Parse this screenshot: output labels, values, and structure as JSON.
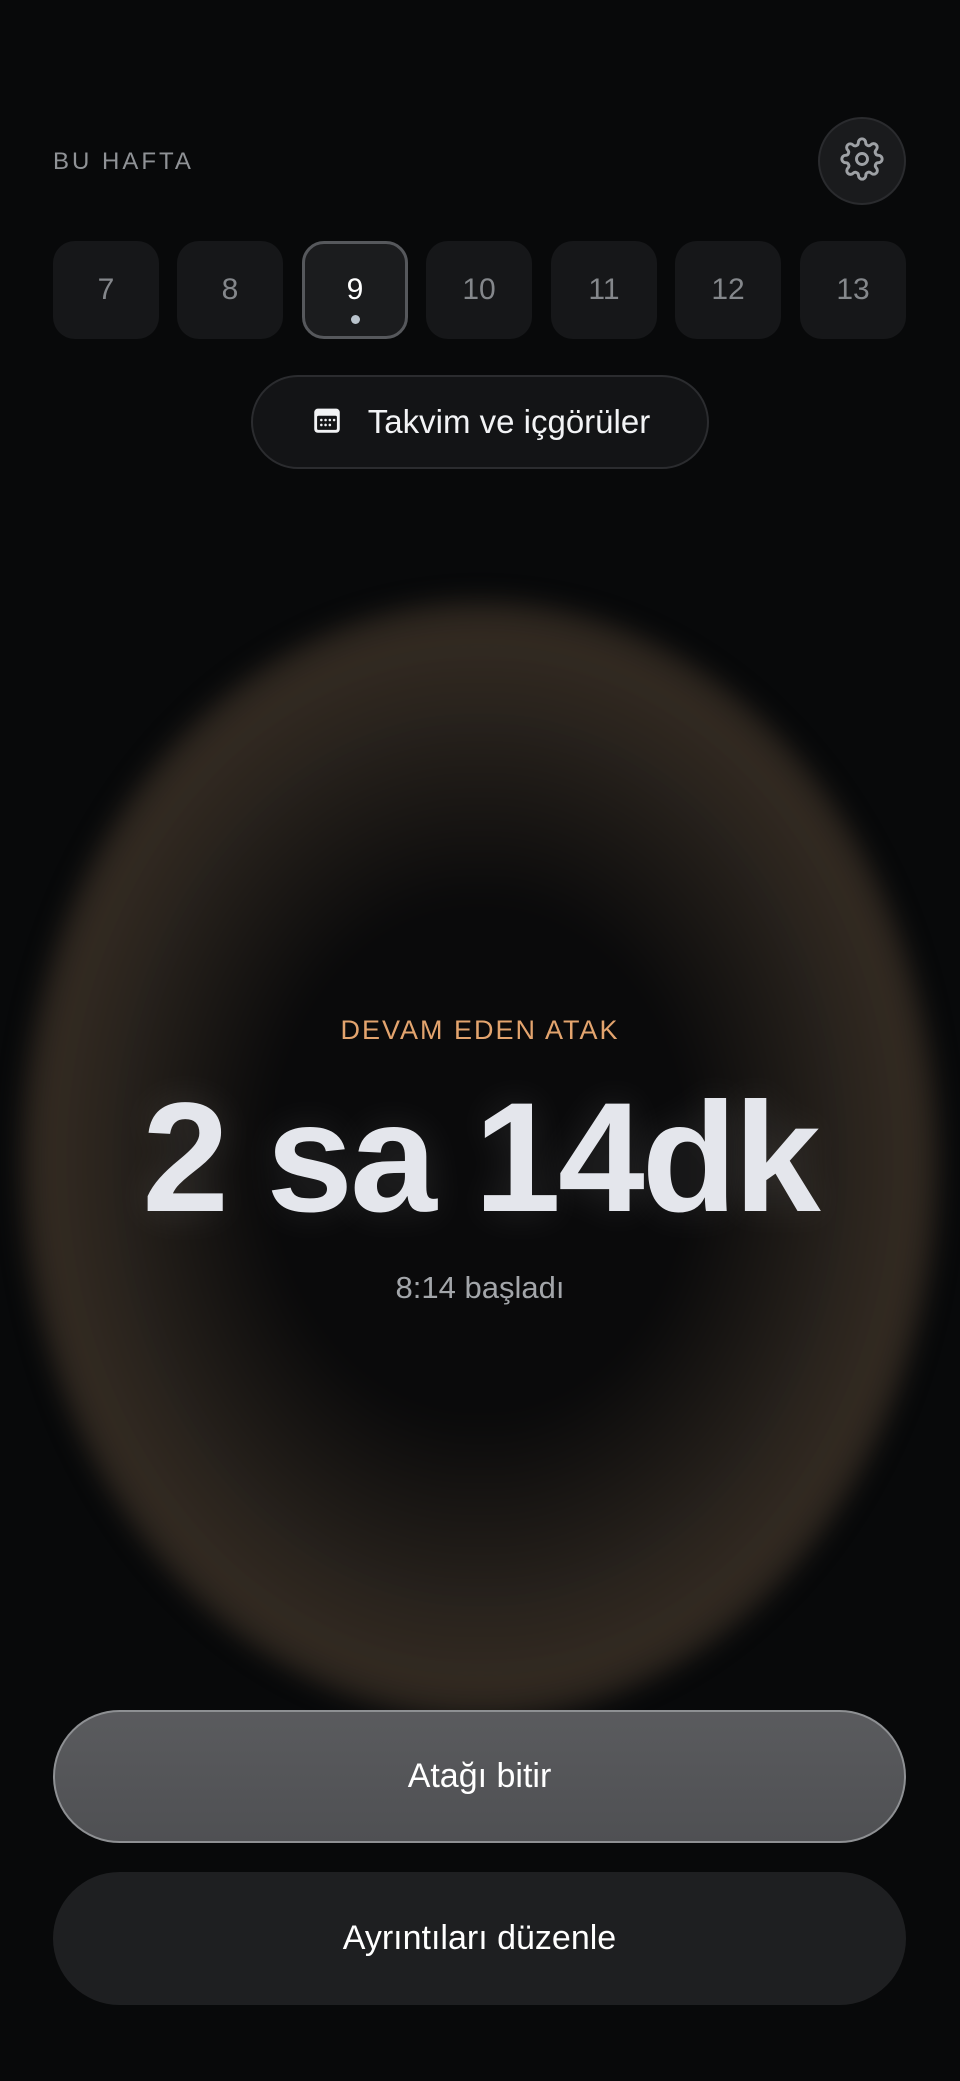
{
  "header": {
    "week_label": "BU HAFTA"
  },
  "days": [
    {
      "label": "7",
      "active": false
    },
    {
      "label": "8",
      "active": false
    },
    {
      "label": "9",
      "active": true
    },
    {
      "label": "10",
      "active": false
    },
    {
      "label": "11",
      "active": false
    },
    {
      "label": "12",
      "active": false
    },
    {
      "label": "13",
      "active": false
    }
  ],
  "calendar_button": {
    "label": "Takvim ve içgörüler",
    "icon": "calendar-icon"
  },
  "attack": {
    "status": "DEVAM EDEN ATAK",
    "duration": "2 sa 14dk",
    "started": "8:14 başladı"
  },
  "actions": {
    "end_label": "Atağı bitir",
    "edit_label": "Ayrıntıları düzenle"
  },
  "colors": {
    "background": "#08090a",
    "accent": "#e3a46e",
    "glow": "#42362a"
  }
}
